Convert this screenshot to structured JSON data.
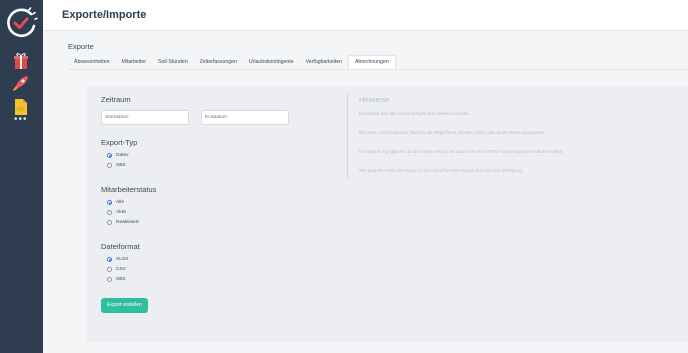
{
  "header": {
    "title": "Exporte/Importe"
  },
  "sidebar": {
    "icons": [
      "clock-check-logo-icon",
      "gift-icon",
      "rocket-icon",
      "file-icon",
      "more-icon"
    ],
    "more_label": "•••"
  },
  "section": {
    "title": "Exporte"
  },
  "tabs": [
    {
      "label": "Abwesenheiten",
      "active": false
    },
    {
      "label": "Mitarbeiter",
      "active": false
    },
    {
      "label": "Soll-Stunden",
      "active": false
    },
    {
      "label": "Zeiterfassungen",
      "active": false
    },
    {
      "label": "Urlaubskontingente",
      "active": false
    },
    {
      "label": "Verfügbarkeiten",
      "active": false
    },
    {
      "label": "Abrechnungen",
      "active": true
    }
  ],
  "form": {
    "zeitraum": {
      "heading": "Zeitraum",
      "start_placeholder": "Startdatum",
      "end_placeholder": "Enddatum"
    },
    "export_typ": {
      "heading": "Export-Typ",
      "options": [
        {
          "label": "Datev",
          "checked": true
        },
        {
          "label": "SBS",
          "checked": false
        }
      ]
    },
    "mitarbeiterstatus": {
      "heading": "Mitarbeiterstatus",
      "options": [
        {
          "label": "Alle",
          "checked": true
        },
        {
          "label": "Aktiv",
          "checked": false
        },
        {
          "label": "Deaktiviert",
          "checked": false
        }
      ]
    },
    "dateiformat": {
      "heading": "Dateiformat",
      "options": [
        {
          "label": "XLSX",
          "checked": true
        },
        {
          "label": "CSV",
          "checked": false
        },
        {
          "label": "SBS",
          "checked": false
        }
      ]
    },
    "submit_label": "Export erstellen"
  },
  "hints": {
    "title": "Hinweise",
    "lines": [
      "Exportiere hier alle Abrechnungen aus diesem Account.",
      "Bei Start- und Enddatum hast Du die Möglichkeit, keinen, einen oder beide Werte anzugeben.",
      "Der Export-Typ gibt an, ob die Daten einfach als Liste oder im DATEV Format exportiert werden sollen.",
      "Wie gewohnt steht der Export in den Dateiformaten Excel und CSV zur Verfügung."
    ]
  },
  "colors": {
    "sidebar": "#2e3e50",
    "accent_button": "#2fbfa0",
    "radio_checked": "#3a7be0",
    "logo_check": "#e8455e"
  }
}
